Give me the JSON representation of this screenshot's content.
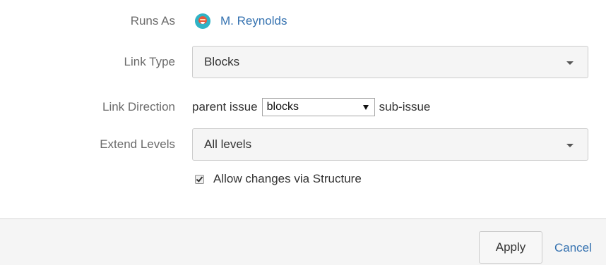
{
  "runs_as": {
    "label": "Runs As",
    "user_name": "M. Reynolds",
    "avatar_icon": "user-avatar-icon"
  },
  "link_type": {
    "label": "Link Type",
    "selected": "Blocks",
    "caret_icon": "chevron-down-icon"
  },
  "link_direction": {
    "label": "Link Direction",
    "prefix": "parent issue",
    "selected": "blocks",
    "suffix": "sub-issue"
  },
  "extend_levels": {
    "label": "Extend Levels",
    "selected": "All levels",
    "caret_icon": "chevron-down-icon"
  },
  "allow_changes": {
    "label": "Allow changes via Structure",
    "checked": true
  },
  "footer": {
    "apply_label": "Apply",
    "cancel_label": "Cancel"
  },
  "colors": {
    "link": "#3572b0",
    "label": "#6b6b6b",
    "footer_bg": "#f5f5f5"
  }
}
